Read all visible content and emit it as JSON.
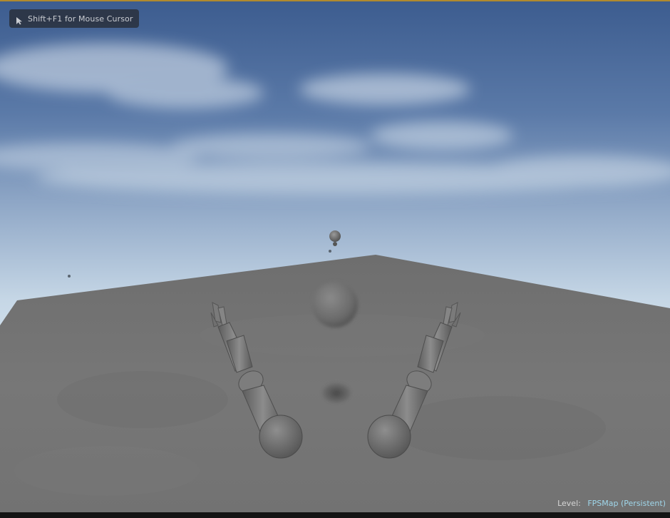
{
  "hint": {
    "text": "Shift+F1 for Mouse Cursor",
    "icon": "mouse-cursor-icon"
  },
  "status": {
    "level_label": "Level:",
    "level_name": "FPSMap (Persistent)"
  },
  "colors": {
    "sky_top": "#3d5f92",
    "sky_horizon": "#c9dcea",
    "floor": "#7a7a7a",
    "level_name": "#9fd6ea",
    "border_gold": "#b08a2e"
  }
}
